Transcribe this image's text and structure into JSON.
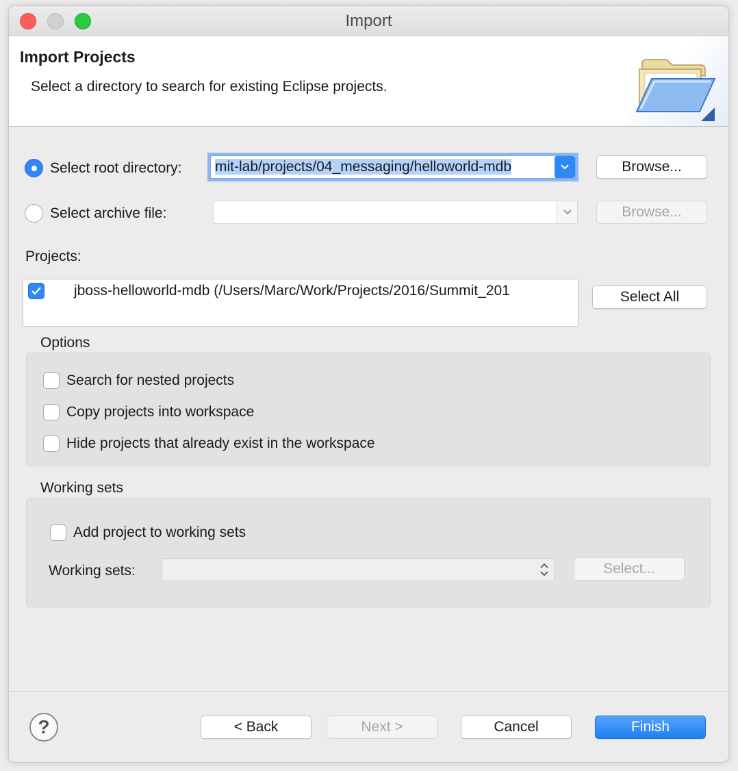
{
  "window": {
    "title": "Import"
  },
  "banner": {
    "title": "Import Projects",
    "description": "Select a directory to search for existing Eclipse projects."
  },
  "source": {
    "root_label": "Select root directory:",
    "root_selected": true,
    "root_value": "mit-lab/projects/04_messaging/helloworld-mdb",
    "root_browse": "Browse...",
    "archive_label": "Select archive file:",
    "archive_selected": false,
    "archive_value": "",
    "archive_browse": "Browse..."
  },
  "projects": {
    "label": "Projects:",
    "items": [
      {
        "checked": true,
        "label": "jboss-helloworld-mdb (/Users/Marc/Work/Projects/2016/Summit_201"
      }
    ],
    "select_all": "Select All"
  },
  "options": {
    "title": "Options",
    "items": [
      {
        "checked": false,
        "label": "Search for nested projects"
      },
      {
        "checked": false,
        "label": "Copy projects into workspace"
      },
      {
        "checked": false,
        "label": "Hide projects that already exist in the workspace"
      }
    ]
  },
  "working_sets": {
    "title": "Working sets",
    "add_label": "Add project to working sets",
    "add_checked": false,
    "field_label": "Working sets:",
    "field_value": "",
    "select_button": "Select..."
  },
  "footer": {
    "help_icon": "question-mark-icon",
    "back": "< Back",
    "next": "Next >",
    "cancel": "Cancel",
    "finish": "Finish"
  },
  "colors": {
    "accent": "#2f88f5",
    "selection": "#b3d3fd",
    "close": "#fc5f57",
    "maximize": "#2acb42"
  }
}
